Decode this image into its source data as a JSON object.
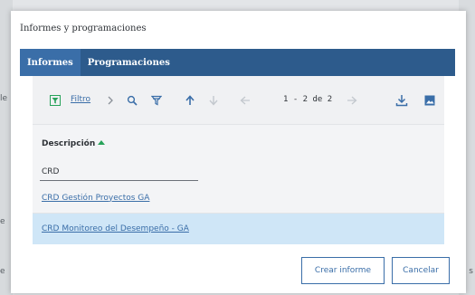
{
  "dialog": {
    "title": "Informes y programaciones",
    "tabs": [
      {
        "label": "Informes",
        "active": true
      },
      {
        "label": "Programaciones",
        "active": false
      }
    ]
  },
  "toolbar": {
    "filter_label": "Filtro",
    "pagination": "1 - 2 de 2",
    "icons": [
      "filter-icon",
      "chevron-right-icon",
      "search-icon",
      "clear-filter-icon",
      "sort-ascending-icon",
      "sort-descending-icon",
      "previous-page-icon",
      "next-page-icon",
      "download-icon",
      "image-view-icon"
    ]
  },
  "table": {
    "column_header": "Descripción",
    "filter_value": "CRD",
    "rows": [
      {
        "label": "CRD Gestión Proyectos GA",
        "selected": false
      },
      {
        "label": "CRD Monitoreo del Desempeño - GA",
        "selected": true
      }
    ]
  },
  "buttons": {
    "create": "Crear informe",
    "cancel": "Cancelar"
  },
  "background": {
    "left_glyphs": [
      "le",
      "e",
      "e"
    ],
    "right_glyphs": [
      "s"
    ]
  },
  "colors": {
    "accent": "#3a6ea8",
    "tabbar": "#2d5b8c",
    "selected_row": "#cfe6f7",
    "sort_arrow": "#27a35a"
  }
}
